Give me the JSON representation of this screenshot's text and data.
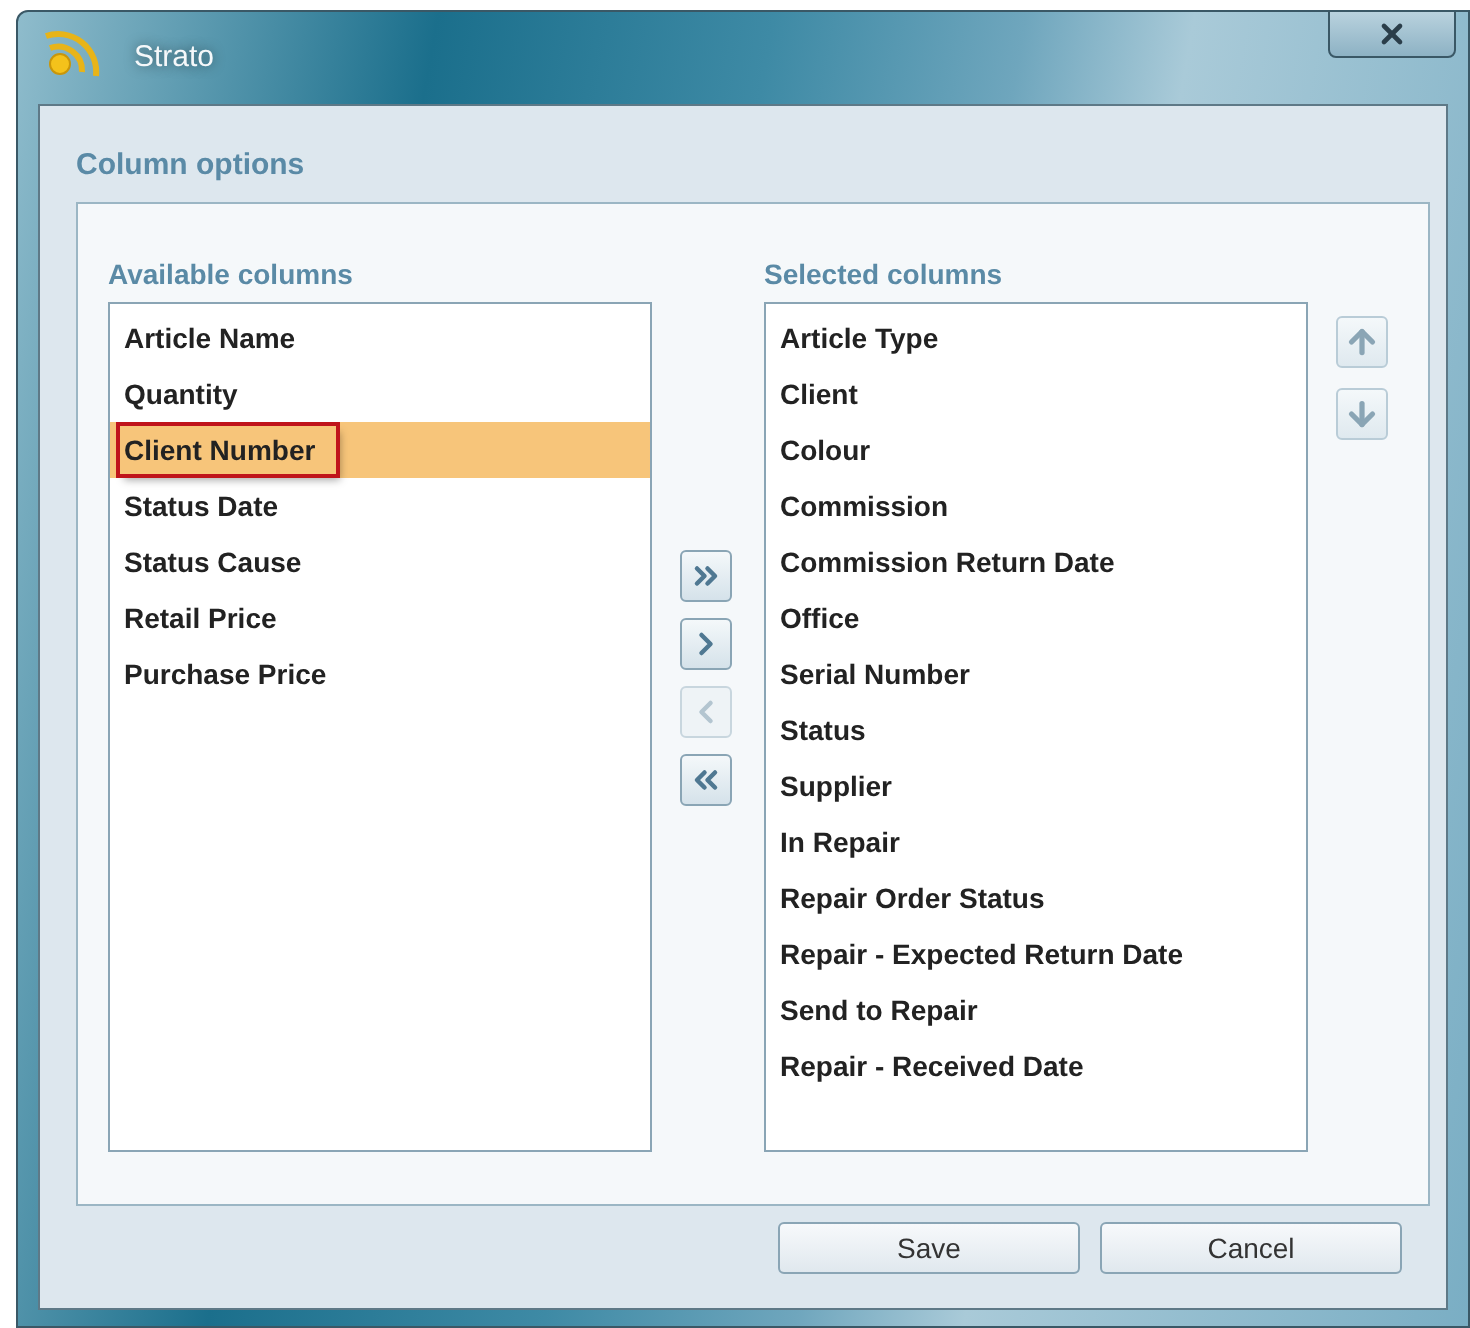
{
  "window": {
    "title": "Strato"
  },
  "section_title": "Column options",
  "available": {
    "label": "Available columns",
    "items": [
      {
        "label": "Article Name",
        "selected": false
      },
      {
        "label": "Quantity",
        "selected": false
      },
      {
        "label": "Client Number",
        "selected": true
      },
      {
        "label": "Status Date",
        "selected": false
      },
      {
        "label": "Status Cause",
        "selected": false
      },
      {
        "label": "Retail Price",
        "selected": false
      },
      {
        "label": "Purchase Price",
        "selected": false
      }
    ]
  },
  "transfer_buttons": [
    {
      "kind": "add-all",
      "disabled": false
    },
    {
      "kind": "add",
      "disabled": false
    },
    {
      "kind": "remove",
      "disabled": true
    },
    {
      "kind": "remove-all",
      "disabled": false
    }
  ],
  "selected": {
    "label": "Selected columns",
    "items": [
      {
        "label": "Article Type",
        "selected": false
      },
      {
        "label": "Client",
        "selected": false
      },
      {
        "label": "Colour",
        "selected": false
      },
      {
        "label": "Commission",
        "selected": false
      },
      {
        "label": "Commission Return Date",
        "selected": false
      },
      {
        "label": "Office",
        "selected": false
      },
      {
        "label": "Serial Number",
        "selected": false
      },
      {
        "label": "Status",
        "selected": false
      },
      {
        "label": "Supplier",
        "selected": false
      },
      {
        "label": "In Repair",
        "selected": false
      },
      {
        "label": "Repair Order Status",
        "selected": false
      },
      {
        "label": "Repair - Expected Return Date",
        "selected": false
      },
      {
        "label": "Send to Repair",
        "selected": false
      },
      {
        "label": "Repair - Received Date",
        "selected": false
      }
    ]
  },
  "buttons": [
    "Save",
    "Cancel"
  ]
}
